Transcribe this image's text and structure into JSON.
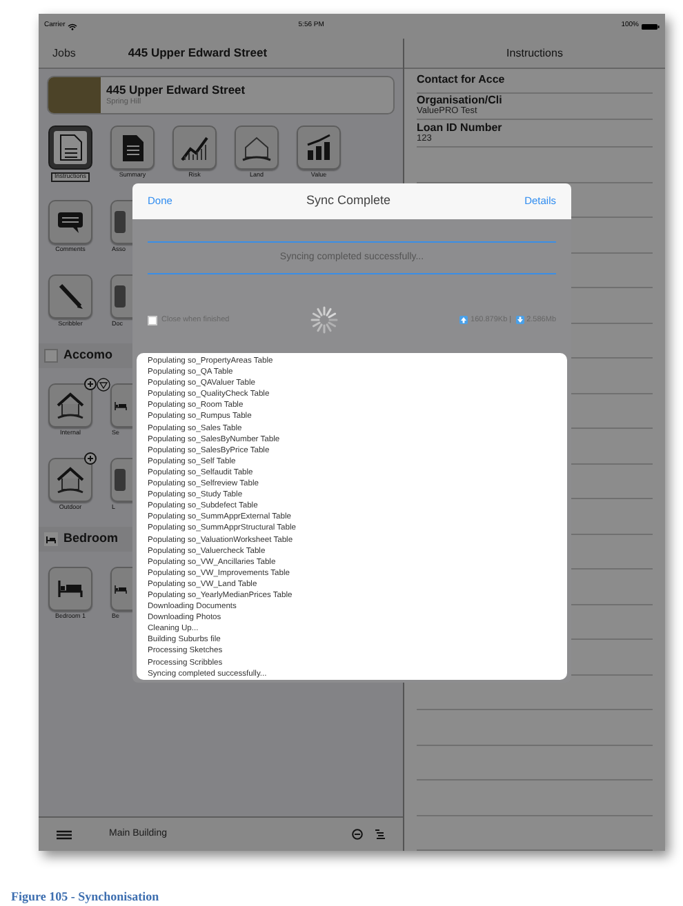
{
  "status_bar": {
    "carrier": "Carrier",
    "time": "5:56 PM",
    "battery": "100%"
  },
  "nav_bar": {
    "back": "Jobs",
    "title": "445 Upper Edward Street"
  },
  "job_card": {
    "title": "445 Upper Edward Street",
    "subtitle": "Spring Hill"
  },
  "left_content": [
    {
      "kind": "tiles",
      "tiles": [
        {
          "kind": "document",
          "label": "Instructions",
          "selected": true
        },
        {
          "kind": "summary",
          "label": "Summary",
          "selected": false
        },
        {
          "kind": "chart",
          "label": "Risk",
          "selected": false
        },
        {
          "kind": "land",
          "label": "Land",
          "selected": false
        },
        {
          "kind": "bars",
          "label": "Value",
          "selected": false
        }
      ]
    },
    {
      "kind": "tiles",
      "tiles": [
        {
          "kind": "comment",
          "label": "Comments",
          "selected": false
        },
        {
          "kind": "generic",
          "label": "Asso",
          "selected": false
        }
      ]
    },
    {
      "kind": "tiles",
      "tiles": [
        {
          "kind": "pen",
          "label": "Scribbler",
          "selected": false
        },
        {
          "kind": "generic",
          "label": "Doc",
          "selected": false
        }
      ]
    },
    {
      "kind": "section",
      "title": "Accomo"
    },
    {
      "kind": "tiles",
      "tiles": [
        {
          "kind": "house",
          "label": "Internal",
          "selected": false,
          "add_badge": true,
          "filter_badge": true
        },
        {
          "kind": "bed",
          "label": "Se",
          "selected": false
        }
      ]
    },
    {
      "kind": "tiles",
      "tiles": [
        {
          "kind": "house",
          "label": "Outdoor",
          "selected": false,
          "add_badge": true
        },
        {
          "kind": "generic",
          "label": "L",
          "selected": false
        }
      ]
    },
    {
      "kind": "section",
      "title": "Bedroom"
    },
    {
      "kind": "tiles",
      "tiles": [
        {
          "kind": "bed",
          "label": "Bedroom 1",
          "selected": false
        },
        {
          "kind": "bed",
          "label": "Be",
          "selected": false
        }
      ]
    }
  ],
  "bottom_bar": {
    "title": "Main Building"
  },
  "right_panel": {
    "title": "Instructions",
    "fields": [
      {
        "label": "Contact for Acce"
      },
      {
        "label": "Organisation/Cli",
        "value": "ValuePRO Test"
      },
      {
        "label": "Loan ID Number",
        "value": "123"
      }
    ]
  },
  "sync_dialog": {
    "left_button": "Done",
    "title": "Sync Complete",
    "right_button": "Details",
    "status": "Syncing completed successfully...",
    "close_when_finished": {
      "label": "Close when finished",
      "checked": false
    },
    "upload": "160.879Kb |",
    "download": "2.586Mb",
    "log": [
      "Populating so_PropertyAreas Table",
      "Populating so_QA Table",
      "Populating so_QAValuer Table",
      "Populating so_QualityCheck Table",
      "Populating so_Room Table",
      "Populating so_Rumpus Table",
      "Populating so_Sales Table",
      "Populating so_SalesByNumber Table",
      "Populating so_SalesByPrice Table",
      "Populating so_Self Table",
      "Populating so_Selfaudit Table",
      "Populating so_Selfreview Table",
      "Populating so_Study Table",
      "Populating so_Subdefect Table",
      "Populating so_SummApprExternal Table",
      "Populating so_SummApprStructural Table",
      "Populating so_ValuationWorksheet Table",
      "Populating so_Valuercheck Table",
      "Populating so_VW_Ancillaries Table",
      "Populating so_VW_Improvements Table",
      "Populating so_VW_Land Table",
      "Populating so_YearlyMedianPrices Table",
      "Downloading Documents",
      "Downloading Photos",
      "Cleaning Up...",
      "Building Suburbs file",
      "Processing Sketches",
      "Processing Scribbles",
      "Syncing completed successfully..."
    ]
  },
  "caption": "Figure 105 - Synchonisation"
}
